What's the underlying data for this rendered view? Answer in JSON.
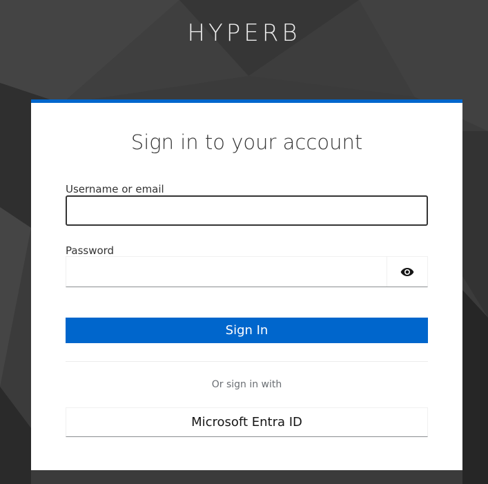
{
  "brand": {
    "name": "HYPERB"
  },
  "login": {
    "title": "Sign in to your account",
    "username_label": "Username or email",
    "username_value": "",
    "password_label": "Password",
    "password_value": "",
    "show_password_icon": "eye-icon",
    "submit_label": "Sign In",
    "social_heading": "Or sign in with",
    "providers": [
      {
        "label": "Microsoft Entra ID"
      }
    ]
  },
  "colors": {
    "accent": "#0066cc",
    "background": "#3a3a3a",
    "card": "#ffffff"
  }
}
